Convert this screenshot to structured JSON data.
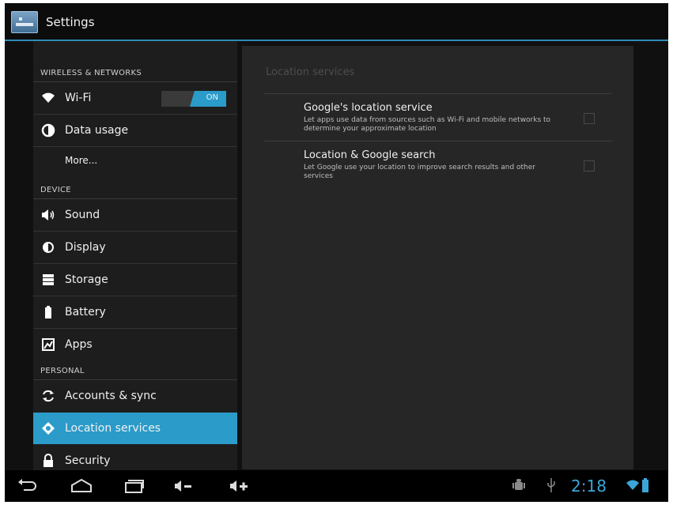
{
  "app": {
    "title": "Settings"
  },
  "sidebar": {
    "sections": [
      {
        "header": "WIRELESS & NETWORKS"
      },
      {
        "header": "DEVICE"
      },
      {
        "header": "PERSONAL"
      }
    ],
    "items": [
      {
        "label": "Wi-Fi",
        "icon": "wifi-icon"
      },
      {
        "label": "Data usage",
        "icon": "data-usage-icon"
      },
      {
        "label": "More..."
      },
      {
        "label": "Sound",
        "icon": "speaker-icon"
      },
      {
        "label": "Display",
        "icon": "brightness-icon"
      },
      {
        "label": "Storage",
        "icon": "storage-icon"
      },
      {
        "label": "Battery",
        "icon": "battery-icon"
      },
      {
        "label": "Apps",
        "icon": "apps-icon"
      },
      {
        "label": "Accounts & sync",
        "icon": "sync-icon"
      },
      {
        "label": "Location services",
        "icon": "location-icon",
        "selected": true
      },
      {
        "label": "Security",
        "icon": "lock-icon"
      }
    ],
    "wifi_toggle": "ON"
  },
  "main": {
    "title": "Location services",
    "prefs": [
      {
        "title": "Google's location service",
        "summary": "Let apps use data from sources such as Wi-Fi and mobile networks to determine your approximate location",
        "checked": false
      },
      {
        "title": "Location & Google search",
        "summary": "Let Google use your location to improve search results and other services",
        "checked": false
      }
    ]
  },
  "status": {
    "time": "2:18"
  },
  "colors": {
    "accent": "#2b9bca",
    "background": "#101010",
    "panel": "#262626"
  }
}
